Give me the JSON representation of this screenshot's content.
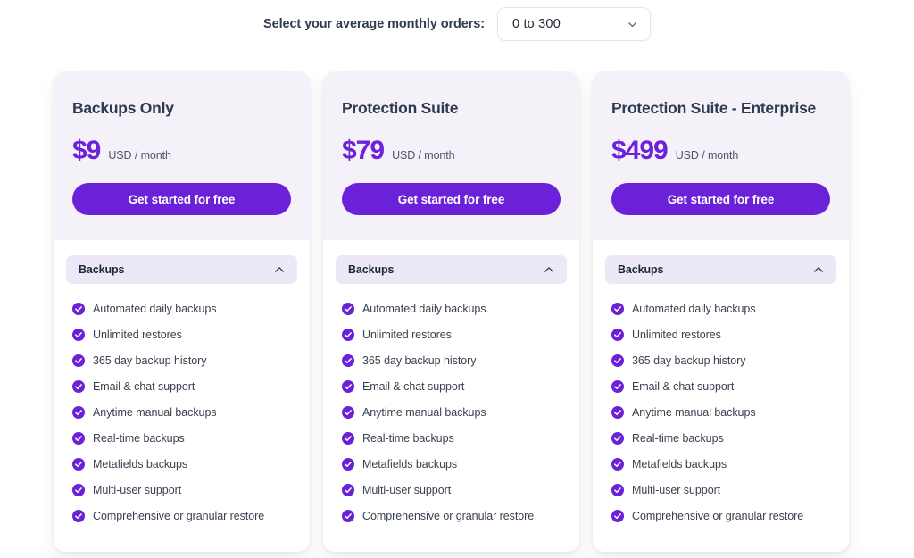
{
  "selector": {
    "label": "Select your average monthly orders:",
    "value": "0 to 300",
    "chevron_icon": "chevron-down-icon"
  },
  "colors": {
    "accent_purple": "#6b21d8",
    "price_purple": "#6d22da",
    "card_head_bg": "#f4f1f9",
    "accordion_bg": "#ece8f8",
    "title_text": "#2e3a4f",
    "page_bg": "#ffffff"
  },
  "plans": [
    {
      "title": "Backups Only",
      "price": "$9",
      "price_unit": "USD / month",
      "cta_label": "Get started for free",
      "section": {
        "title": "Backups",
        "expanded": true,
        "chevron_icon": "chevron-up-icon",
        "features": [
          "Automated daily backups",
          "Unlimited restores",
          "365 day backup history",
          "Email & chat support",
          "Anytime manual backups",
          "Real-time backups",
          "Metafields backups",
          "Multi-user support",
          "Comprehensive or granular restore"
        ]
      }
    },
    {
      "title": "Protection Suite",
      "price": "$79",
      "price_unit": "USD / month",
      "cta_label": "Get started for free",
      "section": {
        "title": "Backups",
        "expanded": true,
        "chevron_icon": "chevron-up-icon",
        "features": [
          "Automated daily backups",
          "Unlimited restores",
          "365 day backup history",
          "Email & chat support",
          "Anytime manual backups",
          "Real-time backups",
          "Metafields backups",
          "Multi-user support",
          "Comprehensive or granular restore"
        ]
      }
    },
    {
      "title": "Protection Suite - Enterprise",
      "price": "$499",
      "price_unit": "USD / month",
      "cta_label": "Get started for free",
      "section": {
        "title": "Backups",
        "expanded": true,
        "chevron_icon": "chevron-up-icon",
        "features": [
          "Automated daily backups",
          "Unlimited restores",
          "365 day backup history",
          "Email & chat support",
          "Anytime manual backups",
          "Real-time backups",
          "Metafields backups",
          "Multi-user support",
          "Comprehensive or granular restore"
        ]
      }
    }
  ]
}
